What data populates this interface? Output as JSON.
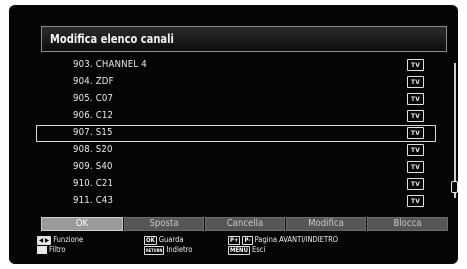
{
  "title": "Modifica elenco canali",
  "channels": [
    {
      "label": "903. CHANNEL 4",
      "type": "TV"
    },
    {
      "label": "904. ZDF",
      "type": "TV"
    },
    {
      "label": "905. C07",
      "type": "TV"
    },
    {
      "label": "906. C12",
      "type": "TV"
    },
    {
      "label": "907. S15",
      "type": "TV"
    },
    {
      "label": "908. S20",
      "type": "TV"
    },
    {
      "label": "909. S40",
      "type": "TV"
    },
    {
      "label": "910. C21",
      "type": "TV"
    },
    {
      "label": "911. C43",
      "type": "TV"
    }
  ],
  "selected_channel_index": 4,
  "buttons": {
    "ok": "OK",
    "move": "Sposta",
    "delete": "Cancella",
    "edit": "Modifica",
    "lock": "Blocca"
  },
  "legend": {
    "function_label": "Funzione",
    "filter_label": "Filtro",
    "ok_key": "OK",
    "watch_label": "Guarda",
    "return_key": "RETURN",
    "back_label": "Indietro",
    "page_up_key": "P+",
    "page_down_key": "P-",
    "page_label": "Pagina AVANTI/INDIETRO",
    "menu_key": "MENU",
    "exit_label": "Esci"
  },
  "colors": {
    "background": "#050505",
    "button": "#565656",
    "button_active": "#9a9a9a"
  }
}
